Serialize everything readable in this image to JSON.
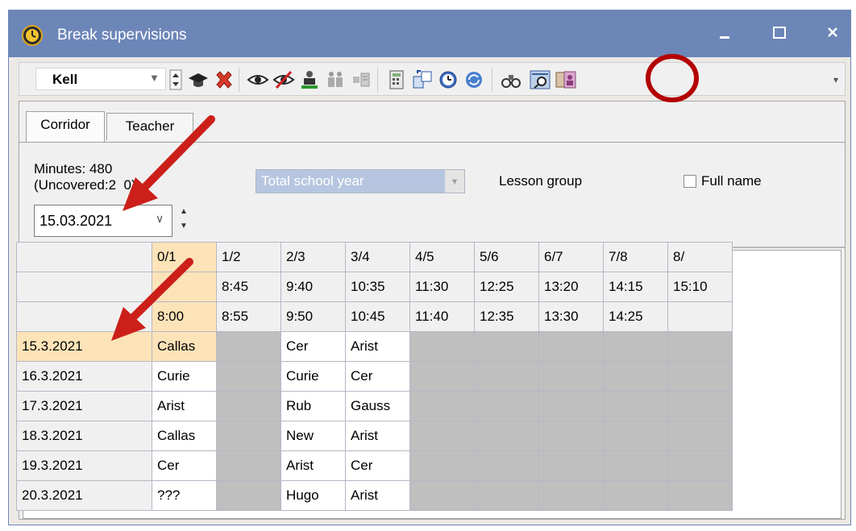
{
  "window": {
    "title": "Break supervisions",
    "controls": {
      "minimize": "minimize-icon",
      "maximize": "maximize-icon",
      "close": "close-icon"
    }
  },
  "toolbar": {
    "selected_value": "Kell",
    "icons": [
      "spinner-icon",
      "teacher-hat-icon",
      "delete-icon",
      "view-icon",
      "hide-icon",
      "assign-teacher-icon",
      "teachers-icon",
      "filter-icon",
      "calculator-icon",
      "swap-icon",
      "clock-icon",
      "refresh-icon",
      "binoculars-icon",
      "highlighted-view-icon",
      "teacher-card-icon"
    ],
    "highlight_color": "#c00000"
  },
  "tabs": [
    {
      "label": "Corridor",
      "active": true
    },
    {
      "label": "Teacher",
      "active": false
    }
  ],
  "info": {
    "minutes": "Minutes: 480",
    "uncovered": "(Uncovered:2  0)",
    "date": "15.03.2021",
    "period": "Total school year",
    "lesson_group": "Lesson group",
    "full_name": "Full name",
    "full_name_checked": false
  },
  "grid": {
    "periods": [
      "0/1",
      "1/2",
      "2/3",
      "3/4",
      "4/5",
      "5/6",
      "6/7",
      "7/8",
      "8/"
    ],
    "start_times": [
      "",
      "8:45",
      "9:40",
      "10:35",
      "11:30",
      "12:25",
      "13:20",
      "14:15",
      "15:10"
    ],
    "end_times": [
      "8:00",
      "8:55",
      "9:50",
      "10:45",
      "11:40",
      "12:35",
      "13:30",
      "14:25",
      ""
    ],
    "rows": [
      {
        "date": "15.3.2021",
        "cells": [
          "Callas",
          "",
          "Cer",
          "Arist",
          "",
          "",
          "",
          "",
          ""
        ]
      },
      {
        "date": "16.3.2021",
        "cells": [
          "Curie",
          "",
          "Curie",
          "Cer",
          "",
          "",
          "",
          "",
          ""
        ]
      },
      {
        "date": "17.3.2021",
        "cells": [
          "Arist",
          "",
          "Rub",
          "Gauss",
          "",
          "",
          "",
          "",
          ""
        ]
      },
      {
        "date": "18.3.2021",
        "cells": [
          "Callas",
          "",
          "New",
          "Arist",
          "",
          "",
          "",
          "",
          ""
        ]
      },
      {
        "date": "19.3.2021",
        "cells": [
          "Cer",
          "",
          "Arist",
          "Cer",
          "",
          "",
          "",
          "",
          ""
        ]
      },
      {
        "date": "20.3.2021",
        "cells": [
          "???",
          "",
          "Hugo",
          "Arist",
          "",
          "",
          "",
          "",
          ""
        ]
      }
    ],
    "colors": {
      "highlight": "#fde3b8",
      "unavailable": "#bfbfbf",
      "available": "#ffffff"
    }
  },
  "annotations": {
    "arrow_color": "#cc1f1a",
    "circle_color": "#b30000"
  }
}
